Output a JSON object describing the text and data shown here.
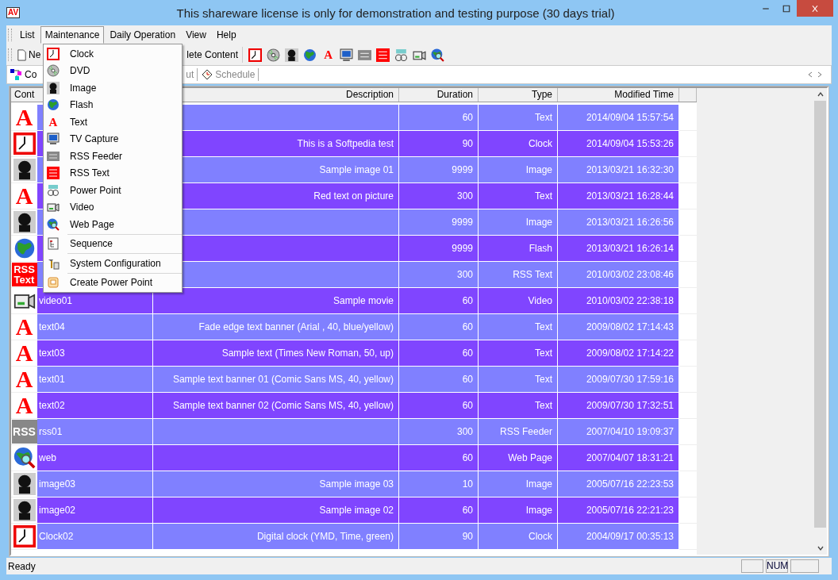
{
  "window": {
    "logo": "AV",
    "title": "This shareware license is only for demonstration and testing purpose (30 days trial)"
  },
  "menu_bar": [
    {
      "label": "List",
      "selected": false
    },
    {
      "label": "Maintenance",
      "selected": true
    },
    {
      "label": "Daily Operation",
      "selected": false
    },
    {
      "label": "View",
      "selected": false
    },
    {
      "label": "Help",
      "selected": false
    }
  ],
  "toolbar": {
    "buttons": [
      {
        "kind": "new",
        "label": "Ne"
      },
      {
        "label": "lete Content"
      }
    ],
    "icons": [
      {
        "kind": "clock"
      },
      {
        "kind": "dvd"
      },
      {
        "kind": "image"
      },
      {
        "kind": "flash"
      },
      {
        "kind": "text",
        "badge": "A"
      },
      {
        "kind": "tv"
      },
      {
        "kind": "rss"
      },
      {
        "kind": "rss_text"
      },
      {
        "kind": "slides"
      },
      {
        "kind": "video"
      },
      {
        "kind": "web"
      }
    ]
  },
  "tabs": [
    {
      "kind": "content",
      "label": "Co",
      "selected": true
    },
    {
      "kind": "layout",
      "label": "ut",
      "selected": false
    },
    {
      "kind": "schedule",
      "label": "Schedule",
      "selected": false
    }
  ],
  "maintenance_menu": [
    [
      {
        "kind": "clock",
        "label": "Clock"
      },
      {
        "kind": "dvd",
        "label": "DVD"
      },
      {
        "kind": "image",
        "label": "Image"
      },
      {
        "kind": "flash",
        "label": "Flash"
      },
      {
        "kind": "text",
        "badge": "A",
        "label": "Text"
      },
      {
        "kind": "tv",
        "label": "TV Capture"
      },
      {
        "kind": "rss",
        "label": "RSS Feeder"
      },
      {
        "kind": "rss_text",
        "label": "RSS Text"
      },
      {
        "kind": "slides",
        "label": "Power Point"
      },
      {
        "kind": "video",
        "label": "Video"
      },
      {
        "kind": "web",
        "label": "Web Page"
      }
    ],
    [
      {
        "kind": "sequence",
        "label": "Sequence"
      }
    ],
    [
      {
        "kind": "config",
        "label": "System Configuration"
      }
    ],
    [
      {
        "kind": "create",
        "label": "Create Power Point"
      }
    ]
  ],
  "table": {
    "columns": [
      "Cont",
      "Description",
      "Duration",
      "Type",
      "Modified Time"
    ],
    "rows": [
      {
        "kind": "text",
        "badge": "A",
        "description": "",
        "duration": "60",
        "type": "Text",
        "modified": "2014/09/04 15:57:54"
      },
      {
        "kind": "clock",
        "description": "This is a Softpedia test",
        "duration": "90",
        "type": "Clock",
        "modified": "2014/09/04 15:53:26"
      },
      {
        "kind": "image",
        "description": "Sample image 01",
        "duration": "9999",
        "type": "Image",
        "modified": "2013/03/21 16:32:30"
      },
      {
        "kind": "text",
        "badge": "A",
        "description": "Red text on picture",
        "duration": "300",
        "type": "Text",
        "modified": "2013/03/21 16:28:44"
      },
      {
        "kind": "image",
        "description": "",
        "duration": "9999",
        "type": "Image",
        "modified": "2013/03/21 16:26:56"
      },
      {
        "kind": "flash",
        "description": "",
        "duration": "9999",
        "type": "Flash",
        "modified": "2013/03/21 16:26:14"
      },
      {
        "kind": "rss_text",
        "badge": "RSS Text",
        "description": "",
        "duration": "300",
        "type": "RSS Text",
        "modified": "2010/03/02 23:08:46"
      },
      {
        "kind": "video",
        "name": "video01",
        "description": "Sample movie",
        "duration": "60",
        "type": "Video",
        "modified": "2010/03/02 22:38:18"
      },
      {
        "kind": "text",
        "badge": "A",
        "name": "text04",
        "description": "Fade edge text banner (Arial , 40, blue/yellow)",
        "duration": "60",
        "type": "Text",
        "modified": "2009/08/02 17:14:43"
      },
      {
        "kind": "text",
        "badge": "A",
        "name": "text03",
        "description": "Sample text (Times New Roman, 50, up)",
        "duration": "60",
        "type": "Text",
        "modified": "2009/08/02 17:14:22"
      },
      {
        "kind": "text",
        "badge": "A",
        "name": "text01",
        "description": "Sample text banner 01 (Comic Sans MS, 40, yellow)",
        "duration": "60",
        "type": "Text",
        "modified": "2009/07/30 17:59:16"
      },
      {
        "kind": "text",
        "badge": "A",
        "name": "text02",
        "description": "Sample text banner 02 (Comic Sans MS, 40, yellow)",
        "duration": "60",
        "type": "Text",
        "modified": "2009/07/30 17:32:51"
      },
      {
        "kind": "rss",
        "badge": "RSS",
        "name": "rss01",
        "description": "",
        "duration": "300",
        "type": "RSS Feeder",
        "modified": "2007/04/10 19:09:37"
      },
      {
        "kind": "web",
        "name": "web",
        "description": "",
        "duration": "60",
        "type": "Web Page",
        "modified": "2007/04/07 18:31:21"
      },
      {
        "kind": "image",
        "name": "image03",
        "description": "Sample image 03",
        "duration": "10",
        "type": "Image",
        "modified": "2005/07/16 22:23:53"
      },
      {
        "kind": "image",
        "name": "image02",
        "description": "Sample image 02",
        "duration": "60",
        "type": "Image",
        "modified": "2005/07/16 22:21:23"
      },
      {
        "kind": "clock",
        "name": "Clock02",
        "description": "Digital clock (YMD, Time, green)",
        "duration": "90",
        "type": "Clock",
        "modified": "2004/09/17 00:35:13"
      }
    ]
  },
  "status_bar": {
    "message": "Ready",
    "indicators": [
      "NUM"
    ]
  }
}
